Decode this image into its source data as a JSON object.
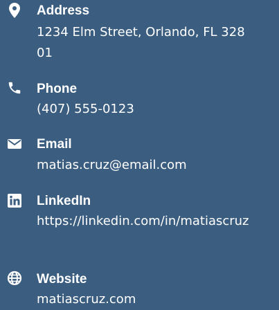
{
  "colors": {
    "background": "#3a5d80",
    "text": "#ffffff"
  },
  "contact": {
    "address": {
      "icon": "map-pin-icon",
      "label": "Address",
      "value": "1234 Elm Street, Orlando, FL 32801"
    },
    "phone": {
      "icon": "phone-icon",
      "label": "Phone",
      "value": "(407) 555-0123"
    },
    "email": {
      "icon": "envelope-icon",
      "label": "Email",
      "value": "matias.cruz@email.com"
    },
    "linkedin": {
      "icon": "linkedin-icon",
      "label": "LinkedIn",
      "value": "https://linkedin.com/in/matiascruz"
    },
    "website": {
      "icon": "globe-icon",
      "label": "Website",
      "value": "matiascruz.com"
    }
  }
}
